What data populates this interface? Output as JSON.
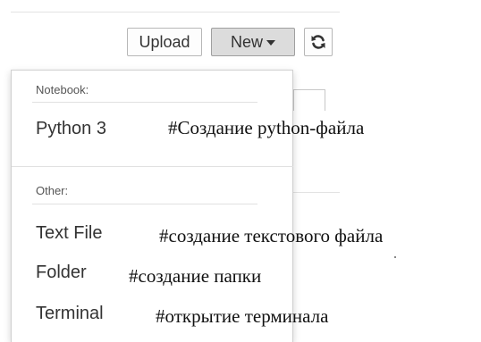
{
  "toolbar": {
    "upload_label": "Upload",
    "new_label": "New",
    "refresh_icon": "refresh-icon"
  },
  "menu": {
    "notebook_header": "Notebook:",
    "other_header": "Other:",
    "items": [
      {
        "label": "Python 3",
        "note": "#Создание python-файла"
      },
      {
        "label": "Text File",
        "note": "#создание текстового файла"
      },
      {
        "label": "Folder",
        "note": "#создание папки"
      },
      {
        "label": "Terminal",
        "note": "#открытие терминала"
      }
    ]
  }
}
